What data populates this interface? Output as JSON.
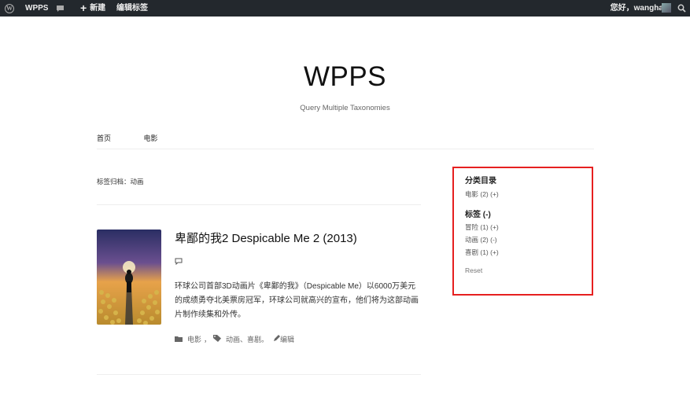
{
  "adminbar": {
    "logo_icon": "wordpress-logo-icon",
    "site_name": "WPPS",
    "comments_icon": "comment-bubble-icon",
    "new_label": "新建",
    "edit_tag_label": "编辑标签",
    "howdy": "您好，wanghao",
    "search_icon": "search-icon"
  },
  "site": {
    "title": "WPPS",
    "tagline": "Query Multiple Taxonomies"
  },
  "nav": {
    "items": [
      "首页",
      "电影"
    ]
  },
  "archive": {
    "title": "标签归档：动画"
  },
  "post": {
    "title": "卑鄙的我2 Despicable Me 2 (2013)",
    "excerpt": "环球公司首部3D动画片《卑鄙的我》（Despicable Me）以6000万美元的成绩勇夺北美票房冠军，环球公司就高兴的宣布，他们将为这部动画片制作续集和外传。",
    "category": "电影",
    "tags": "动画、喜剧。",
    "edit": "编辑"
  },
  "widget": {
    "categories_heading": "分类目录",
    "categories": [
      {
        "label": "电影 (2) (+)"
      }
    ],
    "tags_heading": "标签 (-)",
    "tags": [
      {
        "label": "冒险 (1) (+)"
      },
      {
        "label": "动画 (2) (-)"
      },
      {
        "label": "喜剧 (1) (+)"
      }
    ],
    "reset": "Reset",
    "highlight_color": "#e62020"
  }
}
